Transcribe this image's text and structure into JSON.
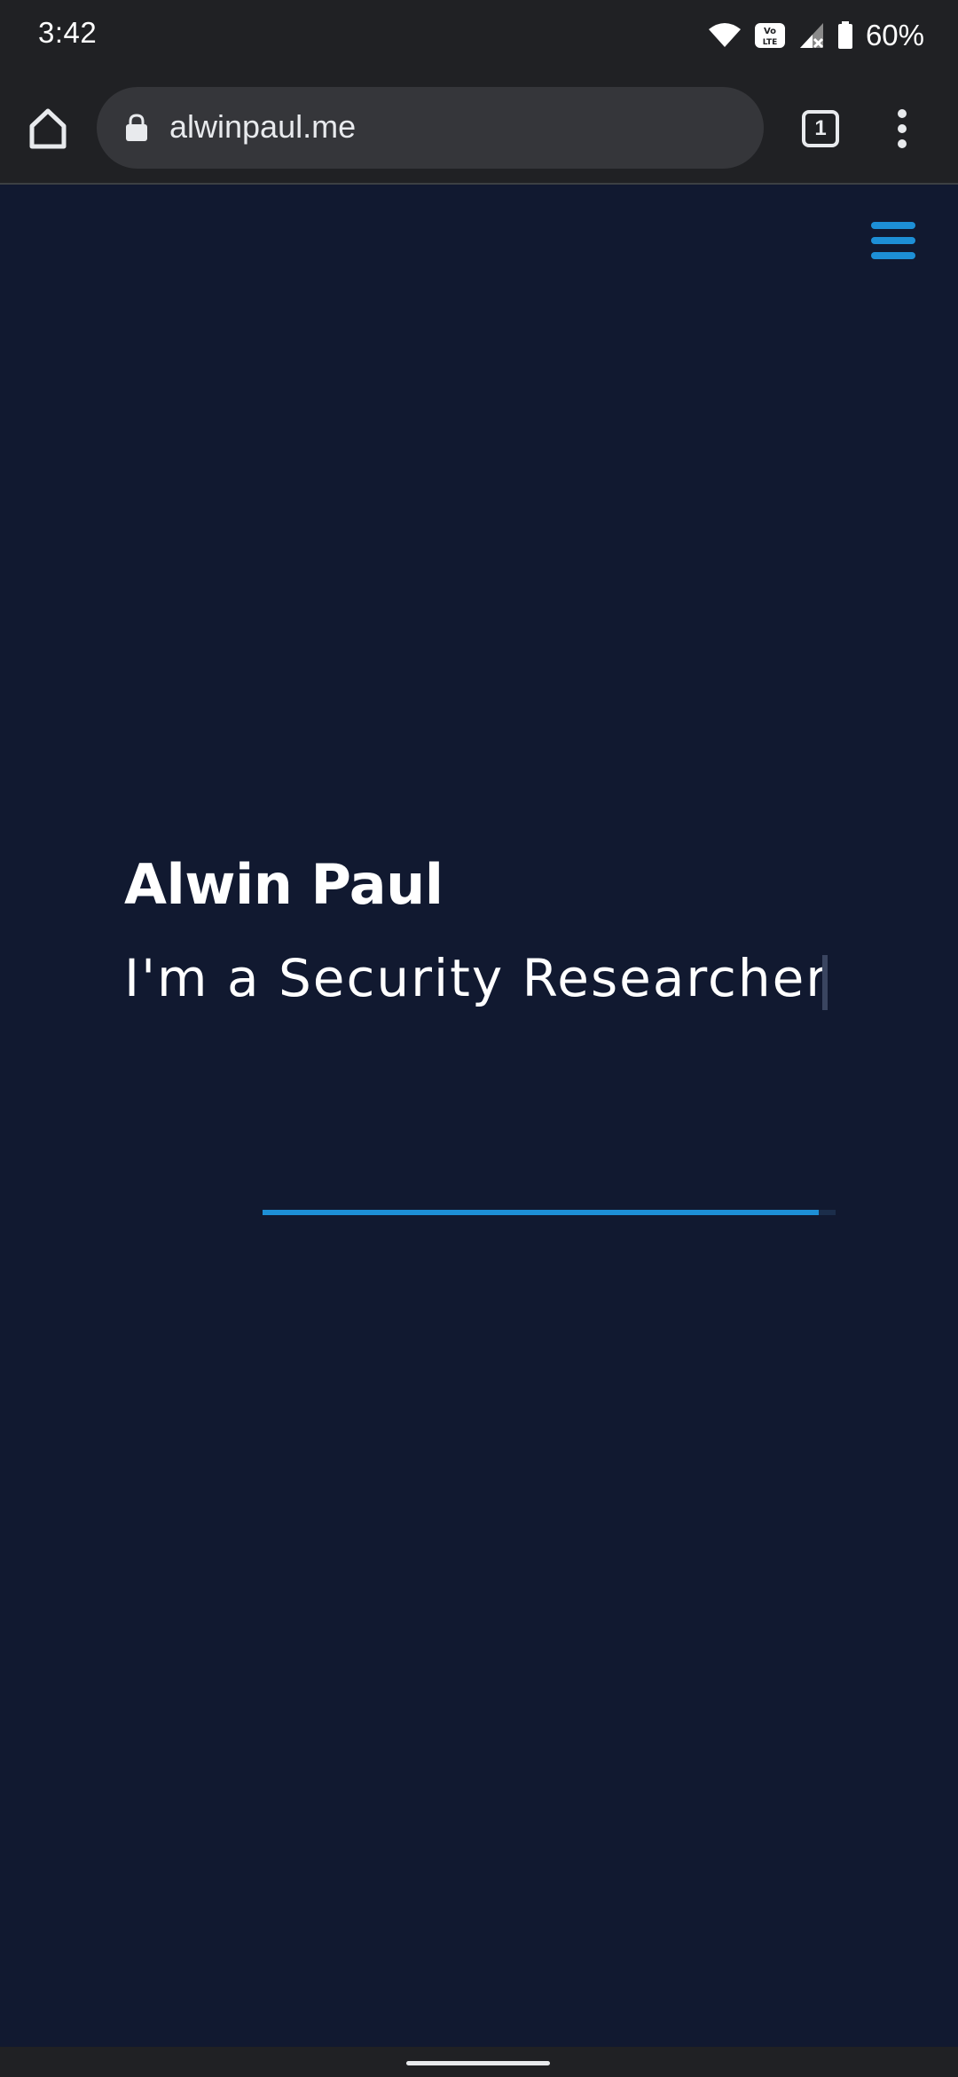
{
  "status_bar": {
    "time": "3:42",
    "battery_percent": "60%",
    "icons": [
      "wifi-icon",
      "volte-icon",
      "cell-signal-icon",
      "battery-icon"
    ]
  },
  "browser": {
    "url": "alwinpaul.me",
    "tab_count": "1",
    "icons": [
      "home-icon",
      "lock-icon",
      "tabs-icon",
      "more-vert-icon"
    ]
  },
  "page": {
    "menu_icon": "hamburger-menu-icon",
    "name": "Alwin Paul",
    "tagline_prefix": "I'm a",
    "tagline_role": "Security Researcher",
    "underline_progress": 0.97,
    "accent_color": "#1d8fd6",
    "background_color": "#111930"
  }
}
